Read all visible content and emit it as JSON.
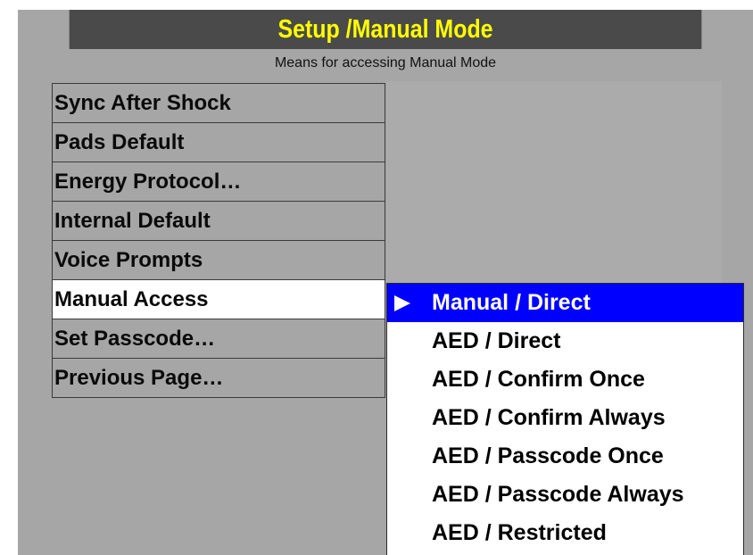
{
  "header": {
    "title": "Setup /Manual Mode",
    "subtitle": "Means for accessing Manual Mode"
  },
  "menu": {
    "items": [
      {
        "label": "Sync After Shock",
        "selected": false
      },
      {
        "label": "Pads Default",
        "selected": false
      },
      {
        "label": "Energy Protocol…",
        "selected": false
      },
      {
        "label": "Internal Default",
        "selected": false
      },
      {
        "label": "Voice Prompts",
        "selected": false
      },
      {
        "label": "Manual Access",
        "selected": true
      },
      {
        "label": "Set Passcode…",
        "selected": false
      },
      {
        "label": "Previous Page…",
        "selected": false
      }
    ]
  },
  "dropdown": {
    "selected_icon": "right-triangle-arrow-icon",
    "options": [
      {
        "label": "Manual / Direct",
        "highlighted": true
      },
      {
        "label": "AED / Direct",
        "highlighted": false
      },
      {
        "label": "AED / Confirm Once",
        "highlighted": false
      },
      {
        "label": "AED / Confirm Always",
        "highlighted": false
      },
      {
        "label": "AED / Passcode Once",
        "highlighted": false
      },
      {
        "label": "AED / Passcode Always",
        "highlighted": false
      },
      {
        "label": "AED / Restricted",
        "highlighted": false
      }
    ]
  },
  "colors": {
    "title_bar_bg": "#4a4a4a",
    "title_text": "#ffff00",
    "screen_bg": "#a6a6a6",
    "highlight_bg": "#0000ff",
    "highlight_text": "#ffffff",
    "selected_item_bg": "#ffffff"
  }
}
